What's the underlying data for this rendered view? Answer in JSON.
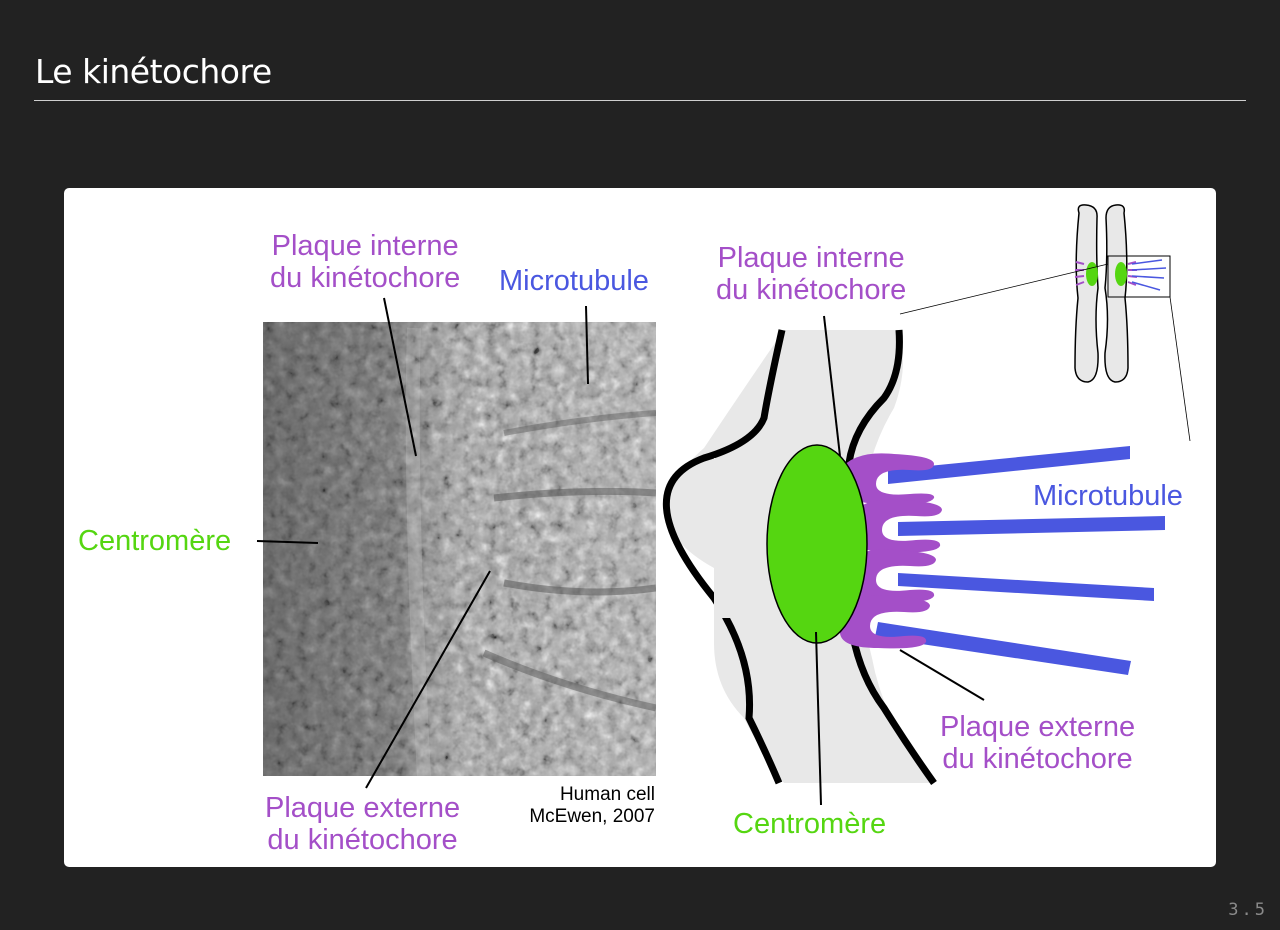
{
  "slide": {
    "title": "Le kinétochore",
    "page_number": "3.5"
  },
  "micrograph": {
    "label_inner_plate": [
      "Plaque interne",
      "du kinétochore"
    ],
    "label_microtubule": "Microtubule",
    "label_centromere": "Centromère",
    "label_outer_plate": [
      "Plaque externe",
      "du kinétochore"
    ],
    "credit": [
      "Human cell",
      "McEwen, 2007"
    ]
  },
  "schematic": {
    "label_inner_plate": [
      "Plaque interne",
      "du kinétochore"
    ],
    "label_microtubule": "Microtubule",
    "label_outer_plate": [
      "Plaque externe",
      "du kinétochore"
    ],
    "label_centromere": "Centromère"
  },
  "colors": {
    "centromere": "#55d611",
    "kinetochore": "#a44fc8",
    "microtubule": "#4a57e0",
    "chromatin": "#e8e8e8"
  }
}
